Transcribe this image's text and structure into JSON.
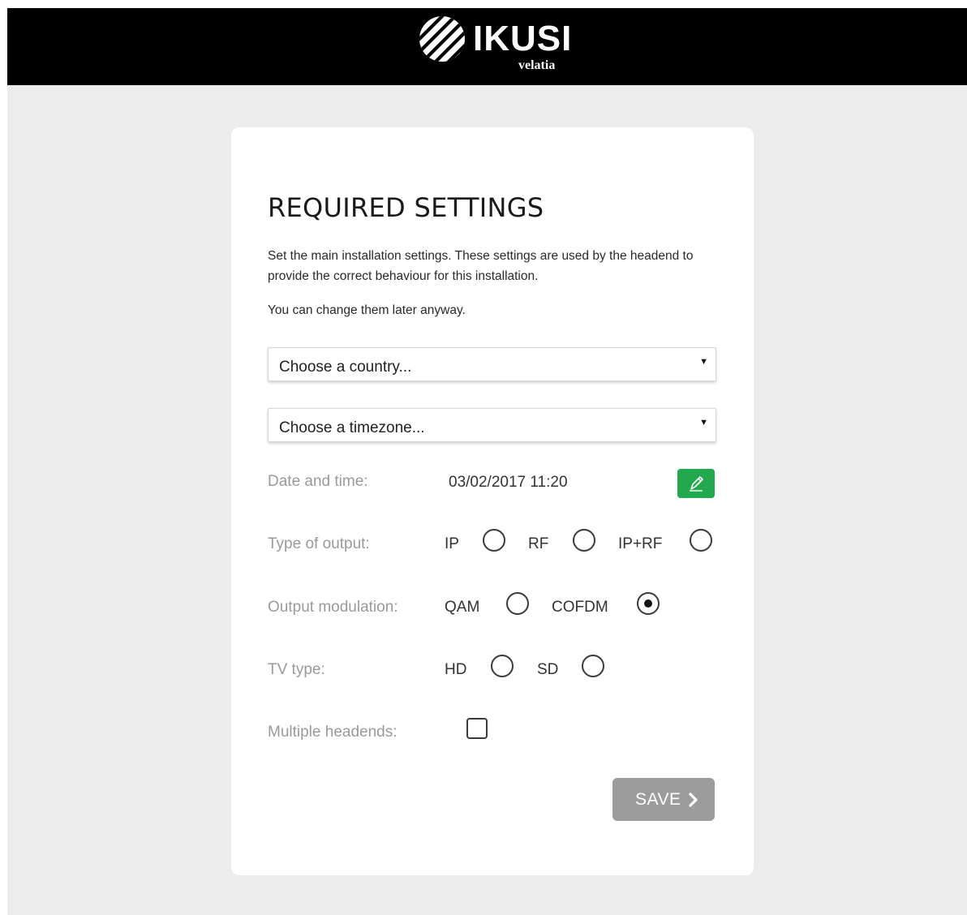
{
  "header": {
    "brand_name": "IKUSI",
    "brand_sub": "velatia"
  },
  "form": {
    "title": "REQUIRED SETTINGS",
    "description": "Set the main installation settings. These settings are used by the headend to provide the correct behaviour for this installation.",
    "note": "You can change them later anyway.",
    "country_select": {
      "value": "Choose a country...",
      "icon": "caret-down-icon"
    },
    "timezone_select": {
      "value": "Choose a timezone...",
      "icon": "caret-down-icon"
    },
    "date_time": {
      "label": "Date and time:",
      "value": "03/02/2017 11:20",
      "edit_icon": "pencil-icon",
      "edit_color": "#22a84f"
    },
    "output_type": {
      "label": "Type of output:",
      "options": [
        {
          "label": "IP",
          "checked": false
        },
        {
          "label": "RF",
          "checked": false
        },
        {
          "label": "IP+RF",
          "checked": false
        }
      ]
    },
    "output_modulation": {
      "label": "Output modulation:",
      "options": [
        {
          "label": "QAM",
          "checked": false
        },
        {
          "label": "COFDM",
          "checked": true
        }
      ]
    },
    "tv_type": {
      "label": "TV type:",
      "options": [
        {
          "label": "HD",
          "checked": false
        },
        {
          "label": "SD",
          "checked": false
        }
      ]
    },
    "multiple_headends": {
      "label": "Multiple headends:",
      "checked": false
    },
    "save_button": {
      "label": "SAVE",
      "icon": "chevron-right-icon",
      "color": "#9c9c9c"
    }
  },
  "colors": {
    "header_bg": "#000000",
    "page_bg": "#ececec",
    "card_bg": "#ffffff",
    "label_text": "#9a9a9a"
  }
}
